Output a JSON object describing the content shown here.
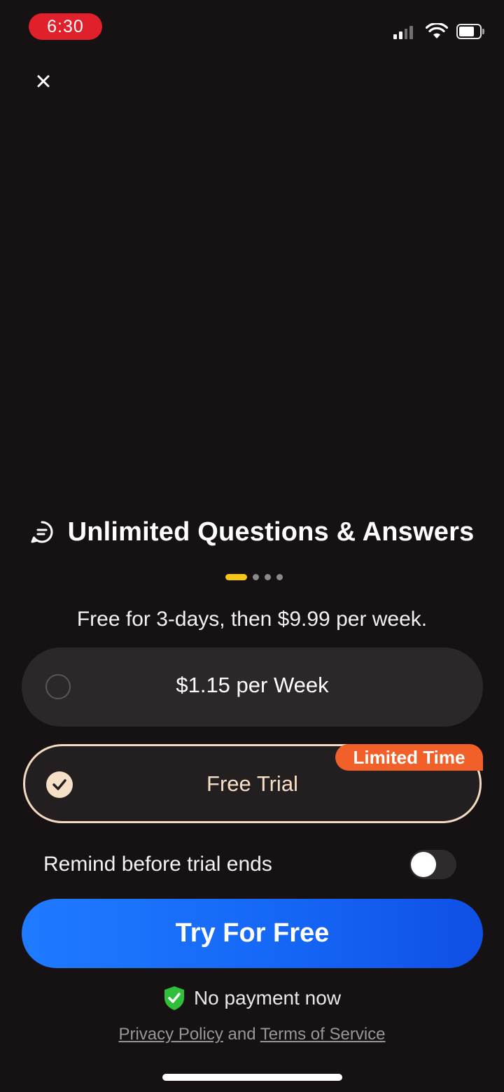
{
  "status_bar": {
    "time": "6:30",
    "time_pill_color": "#e0202a",
    "icons": [
      "signal-icon",
      "wifi-icon",
      "battery-icon"
    ]
  },
  "close_icon": "close-icon",
  "feature": {
    "icon": "chat-bubble-icon",
    "title": "Unlimited Questions & Answers",
    "carousel_pages": 4,
    "carousel_active_index": 0
  },
  "trial_terms": "Free for 3-days, then $9.99 per week.",
  "plans": {
    "weekly": {
      "label": "$1.15 per Week",
      "selected": false
    },
    "trial": {
      "label": "Free Trial",
      "selected": true,
      "badge": "Limited Time"
    }
  },
  "remind": {
    "label": "Remind before trial ends",
    "enabled": false
  },
  "cta": {
    "label": "Try For Free",
    "color": "#1f7bff"
  },
  "no_payment": {
    "icon": "shield-check-icon",
    "text": "No payment now",
    "icon_color": "#2fbf3a"
  },
  "legal": {
    "privacy": "Privacy Policy",
    "and": "and",
    "terms": "Terms of Service"
  },
  "colors": {
    "background": "#161214",
    "accent_badge": "#f2602a",
    "selected_border": "#f3d9bf",
    "dot_active": "#f5c518"
  }
}
